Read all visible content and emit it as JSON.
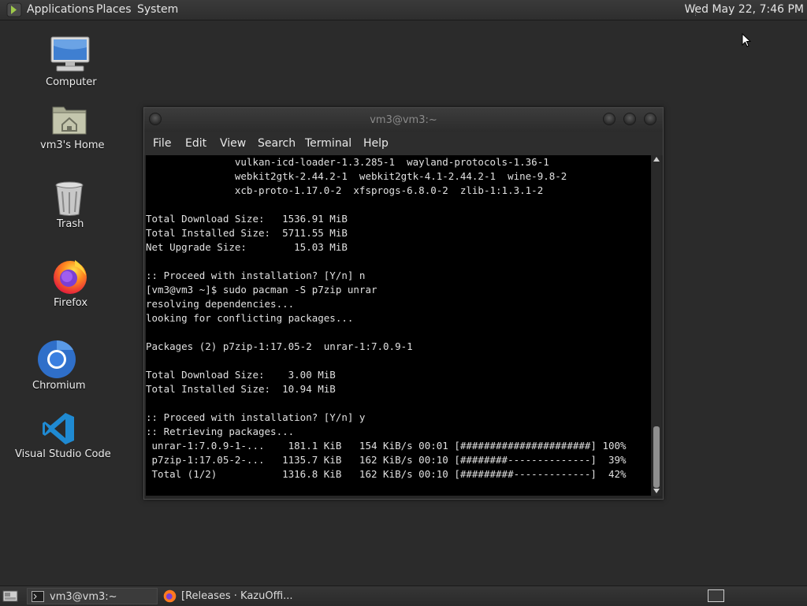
{
  "top_panel": {
    "menus": [
      "Applications",
      "Places",
      "System"
    ],
    "clock": "Wed May 22,  7:46 PM"
  },
  "desktop_icons": [
    {
      "label": "Computer",
      "icon": "computer-icon"
    },
    {
      "label": "vm3's Home",
      "icon": "home-folder-icon"
    },
    {
      "label": "Trash",
      "icon": "trash-icon"
    },
    {
      "label": "Firefox",
      "icon": "firefox-icon"
    },
    {
      "label": "Chromium",
      "icon": "chromium-icon"
    },
    {
      "label": "Visual Studio Code",
      "icon": "vscode-icon"
    }
  ],
  "terminal": {
    "title": "vm3@vm3:~",
    "menu": [
      "File",
      "Edit",
      "View",
      "Search",
      "Terminal",
      "Help"
    ],
    "lines": [
      "               vulkan-icd-loader-1.3.285-1  wayland-protocols-1.36-1",
      "               webkit2gtk-2.44.2-1  webkit2gtk-4.1-2.44.2-1  wine-9.8-2",
      "               xcb-proto-1.17.0-2  xfsprogs-6.8.0-2  zlib-1:1.3.1-2",
      "",
      "Total Download Size:   1536.91 MiB",
      "Total Installed Size:  5711.55 MiB",
      "Net Upgrade Size:        15.03 MiB",
      "",
      ":: Proceed with installation? [Y/n] n",
      "[vm3@vm3 ~]$ sudo pacman -S p7zip unrar",
      "resolving dependencies...",
      "looking for conflicting packages...",
      "",
      "Packages (2) p7zip-1:17.05-2  unrar-1:7.0.9-1",
      "",
      "Total Download Size:    3.00 MiB",
      "Total Installed Size:  10.94 MiB",
      "",
      ":: Proceed with installation? [Y/n] y",
      ":: Retrieving packages...",
      " unrar-1:7.0.9-1-...    181.1 KiB   154 KiB/s 00:01 [######################] 100%",
      " p7zip-1:17.05-2-...   1135.7 KiB   162 KiB/s 00:10 [########--------------]  39%",
      " Total (1/2)           1316.8 KiB   162 KiB/s 00:10 [#########-------------]  42%"
    ]
  },
  "taskbar": {
    "tasks": [
      {
        "label": "vm3@vm3:~",
        "icon": "terminal-icon"
      },
      {
        "label": "[Releases · KazuOffi...",
        "icon": "firefox-icon"
      }
    ]
  }
}
